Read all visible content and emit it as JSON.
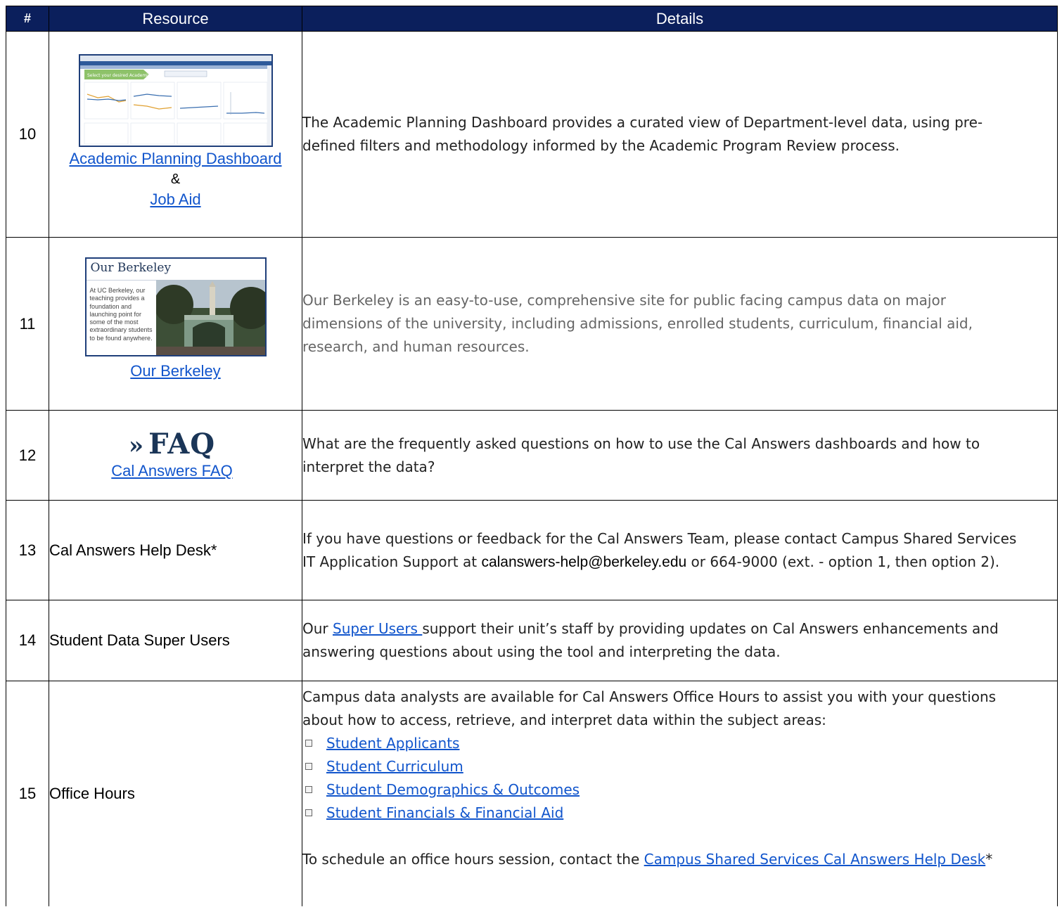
{
  "header": {
    "num": "#",
    "resource": "Resource",
    "details": "Details"
  },
  "rows": {
    "r10": {
      "num": "10",
      "link1": "Academic Planning Dashboard",
      "amp": "&",
      "link2": "Job Aid",
      "details": "The Academic Planning Dashboard provides a curated view of Department-level data, using pre-defined filters and methodology informed by the Academic Program Review process.",
      "thumb_banner": "Select your desired Academic Unit"
    },
    "r11": {
      "num": "11",
      "thumb_title": "Our Berkeley",
      "thumb_caption": "At UC Berkeley, our teaching provides a foundation and launching point for some of the most extraordinary students to be found anywhere.",
      "link": "Our Berkeley",
      "details": "Our Berkeley is an easy-to-use, comprehensive site for public facing campus data on major dimensions of the university, including admissions, enrolled students, curriculum, financial aid, research, and human resources."
    },
    "r12": {
      "num": "12",
      "logo_chev": "»",
      "logo_text": "FAQ",
      "link": "Cal Answers FAQ",
      "details": "What are the frequently asked questions on how to use the Cal Answers dashboards and how to interpret the data?"
    },
    "r13": {
      "num": "13",
      "resource": "Cal Answers Help Desk*",
      "details_pre": "If you have questions or feedback for the Cal Answers Team, please contact Campus Shared Services IT Application Support at ",
      "email": "calanswers-help@berkeley.edu",
      "details_post": " or 664-9000 (ext. - option 1, then option 2)."
    },
    "r14": {
      "num": "14",
      "resource": "Student Data Super Users",
      "details_pre": "Our ",
      "link": "Super Users ",
      "details_post": "support their unit’s staff by providing updates on Cal Answers enhancements and answering questions about using the tool and interpreting the data."
    },
    "r15": {
      "num": "15",
      "resource": "Office Hours",
      "intro": "Campus data analysts are available for Cal Answers Office Hours to assist you with your questions about how to access, retrieve, and interpret data within the subject areas:",
      "items": [
        "Student Applicants",
        "Student Curriculum",
        "Student Demographics & Outcomes",
        "Student Financials & Financial Aid"
      ],
      "schedule_pre": "To schedule an office hours session, contact the ",
      "schedule_link": "Campus Shared Services Cal Answers Help Desk",
      "schedule_post": "*"
    }
  },
  "colors": {
    "header_bg": "#0b1f5c",
    "link": "#1155cc",
    "thumb_border": "#1f3f7a",
    "banner_green": "#8ec26a"
  }
}
